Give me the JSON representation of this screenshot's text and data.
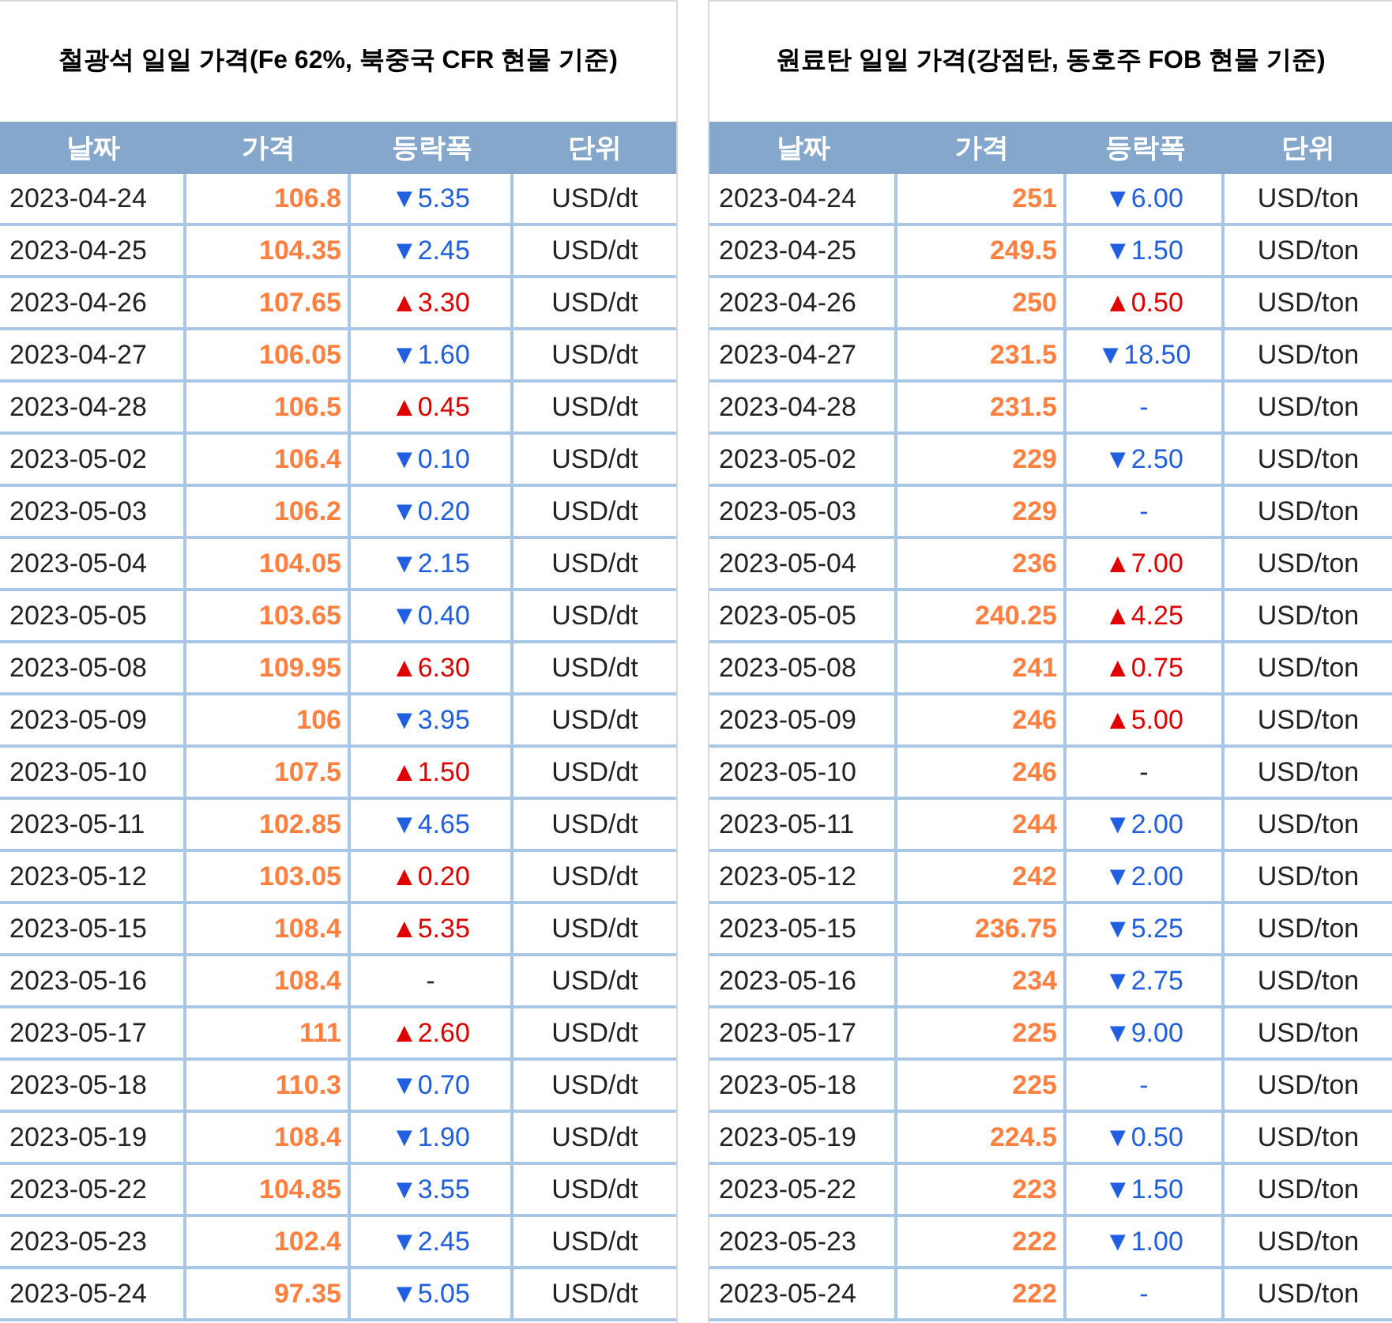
{
  "tables": [
    {
      "title": "철광석 일일 가격(Fe 62%, 북중국 CFR 현물 기준)",
      "columns": [
        "날짜",
        "가격",
        "등락폭",
        "단위"
      ],
      "rows": [
        {
          "date": "2023-04-24",
          "price": "106.8",
          "change": {
            "text": "▼5.35",
            "color": "#1f5fe0"
          },
          "unit": "USD/dt"
        },
        {
          "date": "2023-04-25",
          "price": "104.35",
          "change": {
            "text": "▼2.45",
            "color": "#1f5fe0"
          },
          "unit": "USD/dt"
        },
        {
          "date": "2023-04-26",
          "price": "107.65",
          "change": {
            "text": "▲3.30",
            "color": "#e00000"
          },
          "unit": "USD/dt"
        },
        {
          "date": "2023-04-27",
          "price": "106.05",
          "change": {
            "text": "▼1.60",
            "color": "#1f5fe0"
          },
          "unit": "USD/dt"
        },
        {
          "date": "2023-04-28",
          "price": "106.5",
          "change": {
            "text": "▲0.45",
            "color": "#e00000"
          },
          "unit": "USD/dt"
        },
        {
          "date": "2023-05-02",
          "price": "106.4",
          "change": {
            "text": "▼0.10",
            "color": "#1f5fe0"
          },
          "unit": "USD/dt"
        },
        {
          "date": "2023-05-03",
          "price": "106.2",
          "change": {
            "text": "▼0.20",
            "color": "#1f5fe0"
          },
          "unit": "USD/dt"
        },
        {
          "date": "2023-05-04",
          "price": "104.05",
          "change": {
            "text": "▼2.15",
            "color": "#1f5fe0"
          },
          "unit": "USD/dt"
        },
        {
          "date": "2023-05-05",
          "price": "103.65",
          "change": {
            "text": "▼0.40",
            "color": "#1f5fe0"
          },
          "unit": "USD/dt"
        },
        {
          "date": "2023-05-08",
          "price": "109.95",
          "change": {
            "text": "▲6.30",
            "color": "#e00000"
          },
          "unit": "USD/dt"
        },
        {
          "date": "2023-05-09",
          "price": "106",
          "change": {
            "text": "▼3.95",
            "color": "#1f5fe0"
          },
          "unit": "USD/dt"
        },
        {
          "date": "2023-05-10",
          "price": "107.5",
          "change": {
            "text": "▲1.50",
            "color": "#e00000"
          },
          "unit": "USD/dt"
        },
        {
          "date": "2023-05-11",
          "price": "102.85",
          "change": {
            "text": "▼4.65",
            "color": "#1f5fe0"
          },
          "unit": "USD/dt"
        },
        {
          "date": "2023-05-12",
          "price": "103.05",
          "change": {
            "text": "▲0.20",
            "color": "#e00000"
          },
          "unit": "USD/dt"
        },
        {
          "date": "2023-05-15",
          "price": "108.4",
          "change": {
            "text": "▲5.35",
            "color": "#e00000"
          },
          "unit": "USD/dt"
        },
        {
          "date": "2023-05-16",
          "price": "108.4",
          "change": {
            "text": "-",
            "color": "#222222"
          },
          "unit": "USD/dt"
        },
        {
          "date": "2023-05-17",
          "price": "111",
          "change": {
            "text": "▲2.60",
            "color": "#e00000"
          },
          "unit": "USD/dt"
        },
        {
          "date": "2023-05-18",
          "price": "110.3",
          "change": {
            "text": "▼0.70",
            "color": "#1f5fe0"
          },
          "unit": "USD/dt"
        },
        {
          "date": "2023-05-19",
          "price": "108.4",
          "change": {
            "text": "▼1.90",
            "color": "#1f5fe0"
          },
          "unit": "USD/dt"
        },
        {
          "date": "2023-05-22",
          "price": "104.85",
          "change": {
            "text": "▼3.55",
            "color": "#1f5fe0"
          },
          "unit": "USD/dt"
        },
        {
          "date": "2023-05-23",
          "price": "102.4",
          "change": {
            "text": "▼2.45",
            "color": "#1f5fe0"
          },
          "unit": "USD/dt"
        },
        {
          "date": "2023-05-24",
          "price": "97.35",
          "change": {
            "text": "▼5.05",
            "color": "#1f5fe0"
          },
          "unit": "USD/dt"
        }
      ]
    },
    {
      "title": "원료탄 일일 가격(강점탄, 동호주 FOB 현물 기준)",
      "columns": [
        "날짜",
        "가격",
        "등락폭",
        "단위"
      ],
      "rows": [
        {
          "date": "2023-04-24",
          "price": "251",
          "change": {
            "text": "▼6.00",
            "color": "#1f5fe0"
          },
          "unit": "USD/ton"
        },
        {
          "date": "2023-04-25",
          "price": "249.5",
          "change": {
            "text": "▼1.50",
            "color": "#1f5fe0"
          },
          "unit": "USD/ton"
        },
        {
          "date": "2023-04-26",
          "price": "250",
          "change": {
            "text": "▲0.50",
            "color": "#e00000"
          },
          "unit": "USD/ton"
        },
        {
          "date": "2023-04-27",
          "price": "231.5",
          "change": {
            "text": "▼18.50",
            "color": "#1f5fe0"
          },
          "unit": "USD/ton"
        },
        {
          "date": "2023-04-28",
          "price": "231.5",
          "change": {
            "text": "-",
            "color": "#1f5fe0"
          },
          "unit": "USD/ton"
        },
        {
          "date": "2023-05-02",
          "price": "229",
          "change": {
            "text": "▼2.50",
            "color": "#1f5fe0"
          },
          "unit": "USD/ton"
        },
        {
          "date": "2023-05-03",
          "price": "229",
          "change": {
            "text": "-",
            "color": "#1f5fe0"
          },
          "unit": "USD/ton"
        },
        {
          "date": "2023-05-04",
          "price": "236",
          "change": {
            "text": "▲7.00",
            "color": "#e00000"
          },
          "unit": "USD/ton"
        },
        {
          "date": "2023-05-05",
          "price": "240.25",
          "change": {
            "text": "▲4.25",
            "color": "#e00000"
          },
          "unit": "USD/ton"
        },
        {
          "date": "2023-05-08",
          "price": "241",
          "change": {
            "text": "▲0.75",
            "color": "#e00000"
          },
          "unit": "USD/ton"
        },
        {
          "date": "2023-05-09",
          "price": "246",
          "change": {
            "text": "▲5.00",
            "color": "#e00000"
          },
          "unit": "USD/ton"
        },
        {
          "date": "2023-05-10",
          "price": "246",
          "change": {
            "text": "-",
            "color": "#222222"
          },
          "unit": "USD/ton"
        },
        {
          "date": "2023-05-11",
          "price": "244",
          "change": {
            "text": "▼2.00",
            "color": "#1f5fe0"
          },
          "unit": "USD/ton"
        },
        {
          "date": "2023-05-12",
          "price": "242",
          "change": {
            "text": "▼2.00",
            "color": "#1f5fe0"
          },
          "unit": "USD/ton"
        },
        {
          "date": "2023-05-15",
          "price": "236.75",
          "change": {
            "text": "▼5.25",
            "color": "#1f5fe0"
          },
          "unit": "USD/ton"
        },
        {
          "date": "2023-05-16",
          "price": "234",
          "change": {
            "text": "▼2.75",
            "color": "#1f5fe0"
          },
          "unit": "USD/ton"
        },
        {
          "date": "2023-05-17",
          "price": "225",
          "change": {
            "text": "▼9.00",
            "color": "#1f5fe0"
          },
          "unit": "USD/ton"
        },
        {
          "date": "2023-05-18",
          "price": "225",
          "change": {
            "text": "-",
            "color": "#1f5fe0"
          },
          "unit": "USD/ton"
        },
        {
          "date": "2023-05-19",
          "price": "224.5",
          "change": {
            "text": "▼0.50",
            "color": "#1f5fe0"
          },
          "unit": "USD/ton"
        },
        {
          "date": "2023-05-22",
          "price": "223",
          "change": {
            "text": "▼1.50",
            "color": "#1f5fe0"
          },
          "unit": "USD/ton"
        },
        {
          "date": "2023-05-23",
          "price": "222",
          "change": {
            "text": "▼1.00",
            "color": "#1f5fe0"
          },
          "unit": "USD/ton"
        },
        {
          "date": "2023-05-24",
          "price": "222",
          "change": {
            "text": "-",
            "color": "#1f5fe0"
          },
          "unit": "USD/ton"
        }
      ]
    }
  ]
}
